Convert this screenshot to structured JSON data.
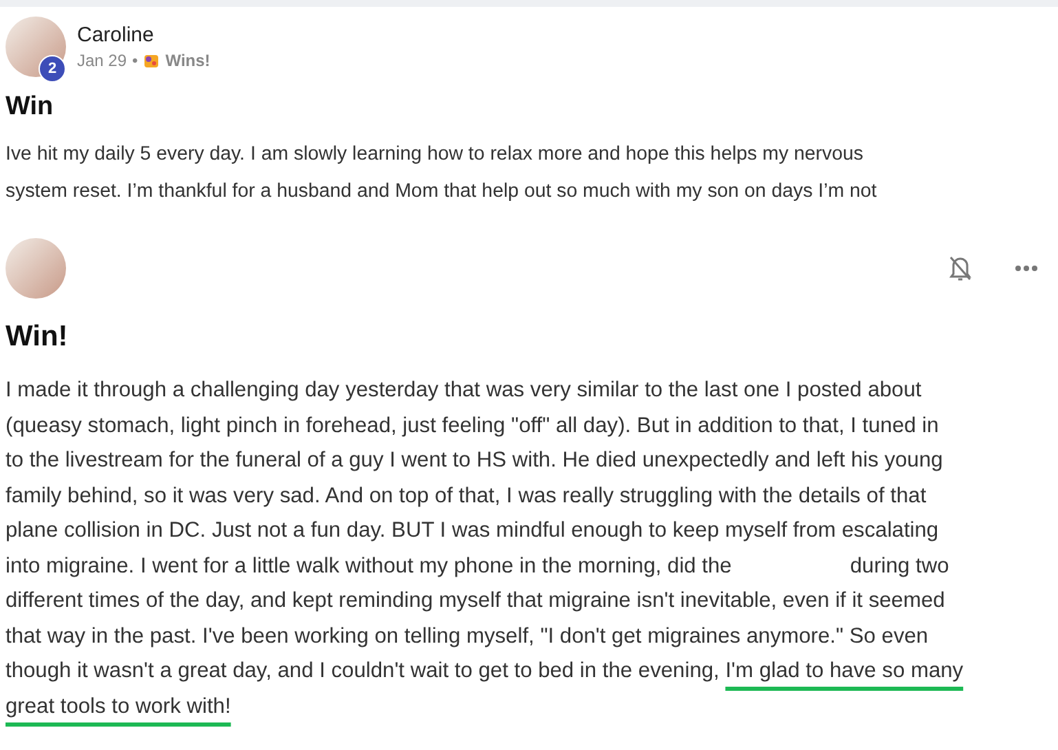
{
  "posts": [
    {
      "author": "Caroline",
      "badge": "2",
      "date": "Jan 29",
      "separator": "•",
      "category": "Wins!",
      "title": "Win",
      "body": [
        [
          {
            "kind": "text",
            "text": "Ive hit my daily 5 every day. I am slowly learning how to relax more and hope this helps my nervous"
          }
        ],
        [
          {
            "kind": "text",
            "text": "system reset. I’m thankful for a husband and Mom that help out so much with my son on days I’m not"
          }
        ]
      ]
    },
    {
      "title": "Win!",
      "actions": [
        {
          "kind": "mute"
        },
        {
          "kind": "more"
        }
      ],
      "body": [
        [
          {
            "kind": "text",
            "text": "I made it through a challenging day yesterday that was very similar to the last one I posted about"
          }
        ],
        [
          {
            "kind": "text",
            "text": "(queasy stomach, light pinch in forehead, just feeling \"off\" all day). But in addition to that, I tuned in"
          }
        ],
        [
          {
            "kind": "text",
            "text": "to the livestream for the funeral of a guy I went to HS with. He died unexpectedly and left his young"
          }
        ],
        [
          {
            "kind": "text",
            "text": "family behind, so it was very sad. And on top of that, I was really struggling with the details of that"
          }
        ],
        [
          {
            "kind": "text",
            "text": "plane collision in DC. Just not a fun day. BUT I was mindful enough to keep myself from escalating"
          }
        ],
        [
          {
            "kind": "text",
            "text": "into migraine. I went for a little walk without my phone in the morning, did the"
          },
          {
            "kind": "gap"
          },
          {
            "kind": "text",
            "text": "during two"
          }
        ],
        [
          {
            "kind": "text",
            "text": "different times of the day, and kept reminding myself that migraine isn't inevitable, even if it seemed"
          }
        ],
        [
          {
            "kind": "text",
            "text": "that way in the past. I've been working on telling myself, \"I don't get migraines anymore.\" So even"
          }
        ],
        [
          {
            "kind": "text",
            "text": "though it wasn't a great day, and I couldn't wait to get to bed in the evening, "
          },
          {
            "kind": "highlight",
            "text": "I'm glad to have so many"
          }
        ],
        [
          {
            "kind": "highlight",
            "text": "great tools to work with!"
          }
        ]
      ]
    }
  ]
}
